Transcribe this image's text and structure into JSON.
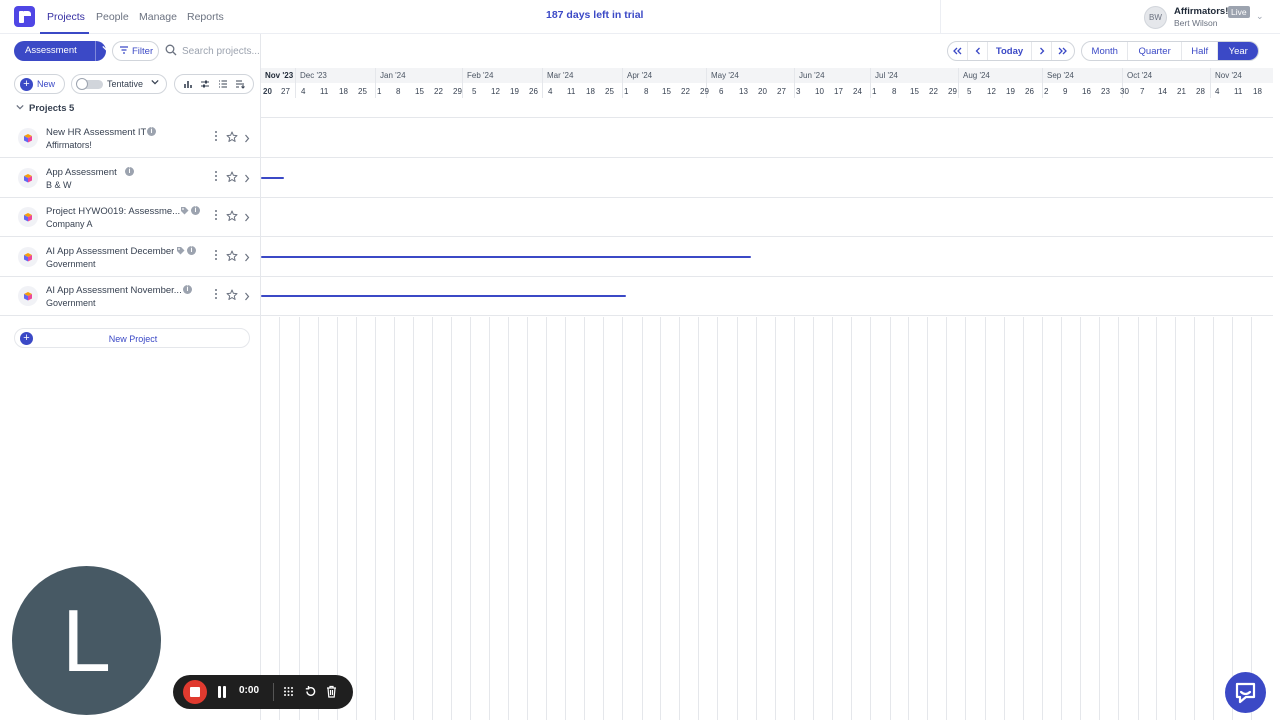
{
  "nav": {
    "tabs": [
      "Projects",
      "People",
      "Manage",
      "Reports"
    ],
    "active_tab": "Projects",
    "trial_text": "187 days left in trial",
    "account": {
      "initials": "BW",
      "company": "Affirmators!",
      "badge": "Live",
      "user": "Bert Wilson"
    }
  },
  "toolbar": {
    "view_label": "Assessment",
    "filter_label": "Filter",
    "search_placeholder": "Search projects...",
    "today_label": "Today",
    "scales": [
      "Month",
      "Quarter",
      "Half",
      "Year"
    ],
    "active_scale": "Year"
  },
  "controls": {
    "new_label": "New",
    "tentative_label": "Tentative"
  },
  "projects_header": {
    "label": "Projects",
    "count": "5"
  },
  "timeline": {
    "months": [
      "Nov '23",
      "Dec '23",
      "Jan '24",
      "Feb '24",
      "Mar '24",
      "Apr '24",
      "May '24",
      "Jun '24",
      "Jul '24",
      "Aug '24",
      "Sep '24",
      "Oct '24",
      "Nov '24"
    ],
    "current_month": "Nov '23",
    "weeks": [
      "20",
      "27",
      "4",
      "11",
      "18",
      "25",
      "1",
      "8",
      "15",
      "22",
      "29",
      "5",
      "12",
      "19",
      "26",
      "4",
      "11",
      "18",
      "25",
      "1",
      "8",
      "15",
      "22",
      "29",
      "6",
      "13",
      "20",
      "27",
      "3",
      "10",
      "17",
      "24",
      "1",
      "8",
      "15",
      "22",
      "29",
      "5",
      "12",
      "19",
      "26",
      "2",
      "9",
      "16",
      "23",
      "30",
      "7",
      "14",
      "21",
      "28",
      "4",
      "11",
      "18"
    ]
  },
  "projects": [
    {
      "title": "New HR Assessment IT",
      "client": "Affirmators!",
      "has_tag": false,
      "bar": null
    },
    {
      "title": "App Assessment",
      "client": "B & W",
      "has_tag": false,
      "bar": {
        "start_week": 0,
        "end_week": 1.2
      }
    },
    {
      "title": "Project HYWO019: Assessme...",
      "client": "Company A",
      "has_tag": true,
      "bar": null
    },
    {
      "title": "AI App Assessment December",
      "client": "Government",
      "has_tag": true,
      "bar": {
        "start_week": 0,
        "end_week": 25.8
      }
    },
    {
      "title": "AI App Assessment November...",
      "client": "Government",
      "has_tag": false,
      "bar": {
        "start_week": 0,
        "end_week": 19.2
      }
    }
  ],
  "new_project_label": "New Project",
  "recorder": {
    "time": "0:00"
  },
  "camera": {
    "initial": "L"
  },
  "colors": {
    "accent": "#3b49c6",
    "record": "#e03a2f"
  }
}
